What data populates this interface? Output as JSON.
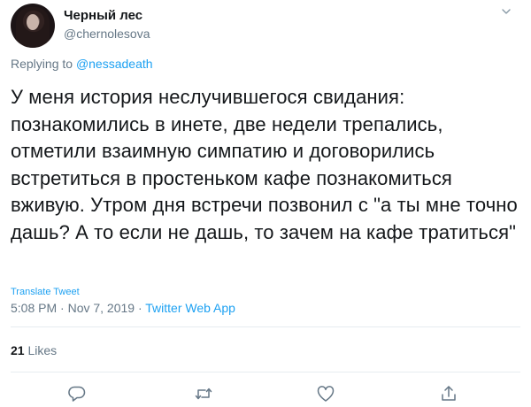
{
  "author": {
    "display_name": "Черный лес",
    "handle": "@chernolesova"
  },
  "reply": {
    "prefix": "Replying to ",
    "mention": "@nessadeath"
  },
  "tweet": {
    "text": "У меня история неслучившегося свидания: познакомились в инете, две недели трепались, отметили взаимную симпатию и договорились встретиться в простеньком кафе познакомиться вживую. Утром дня встречи позвонил с \"а ты мне точно дашь? А то если не дашь, то зачем на кафе тратиться\"",
    "translate_label": "Translate Tweet",
    "time": "5:08 PM · Nov 7, 2019 · ",
    "app": "Twitter Web App"
  },
  "stats": {
    "likes_count": "21",
    "likes_label": " Likes"
  },
  "icons": {
    "reply": "reply-icon",
    "retweet": "retweet-icon",
    "like": "heart-icon",
    "share": "share-icon",
    "more": "chevron-down-icon"
  },
  "colors": {
    "accent": "#1da1f2",
    "secondary_text": "#657786",
    "primary_text": "#14171a",
    "divider": "#e6ecf0"
  }
}
